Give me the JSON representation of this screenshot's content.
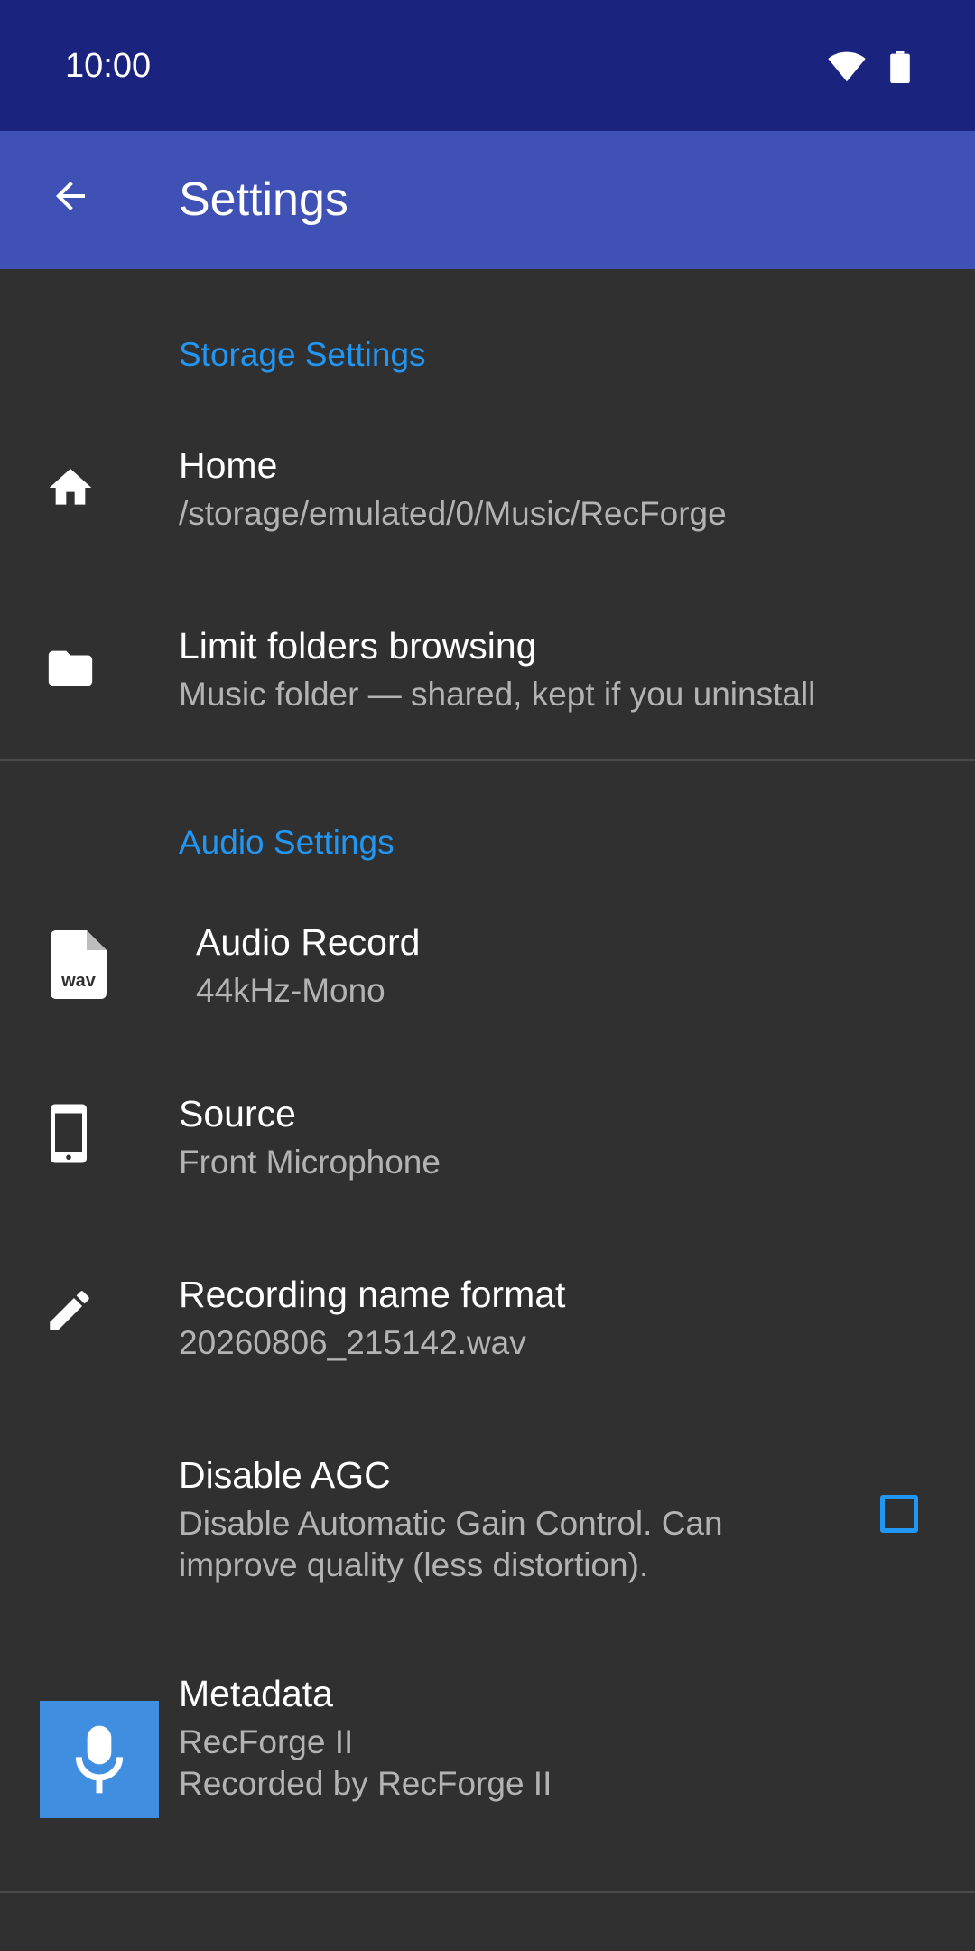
{
  "status_bar": {
    "time": "10:00"
  },
  "app_bar": {
    "title": "Settings"
  },
  "storage": {
    "header": "Storage Settings",
    "home": {
      "title": "Home",
      "summary": "/storage/emulated/0/Music/RecForge"
    },
    "limit_folders": {
      "title": "Limit folders browsing",
      "summary": "Music folder — shared, kept if you uninstall"
    }
  },
  "audio": {
    "header": "Audio Settings",
    "audio_record": {
      "title": "Audio Record",
      "summary": "44kHz-Mono",
      "icon_text": "wav"
    },
    "source": {
      "title": "Source",
      "summary": "Front Microphone"
    },
    "name_format": {
      "title": "Recording name format",
      "summary": "20260806_215142.wav"
    },
    "disable_agc": {
      "title": "Disable AGC",
      "summary": "Disable Automatic Gain Control. Can improve quality (less distortion).",
      "checked": false
    },
    "metadata": {
      "title": "Metadata",
      "summary_line1": "RecForge II",
      "summary_line2": "Recorded by RecForge II"
    }
  },
  "colors": {
    "status_bar": "#1a237e",
    "app_bar": "#3f51b5",
    "accent": "#2196f3",
    "background": "#303030"
  }
}
